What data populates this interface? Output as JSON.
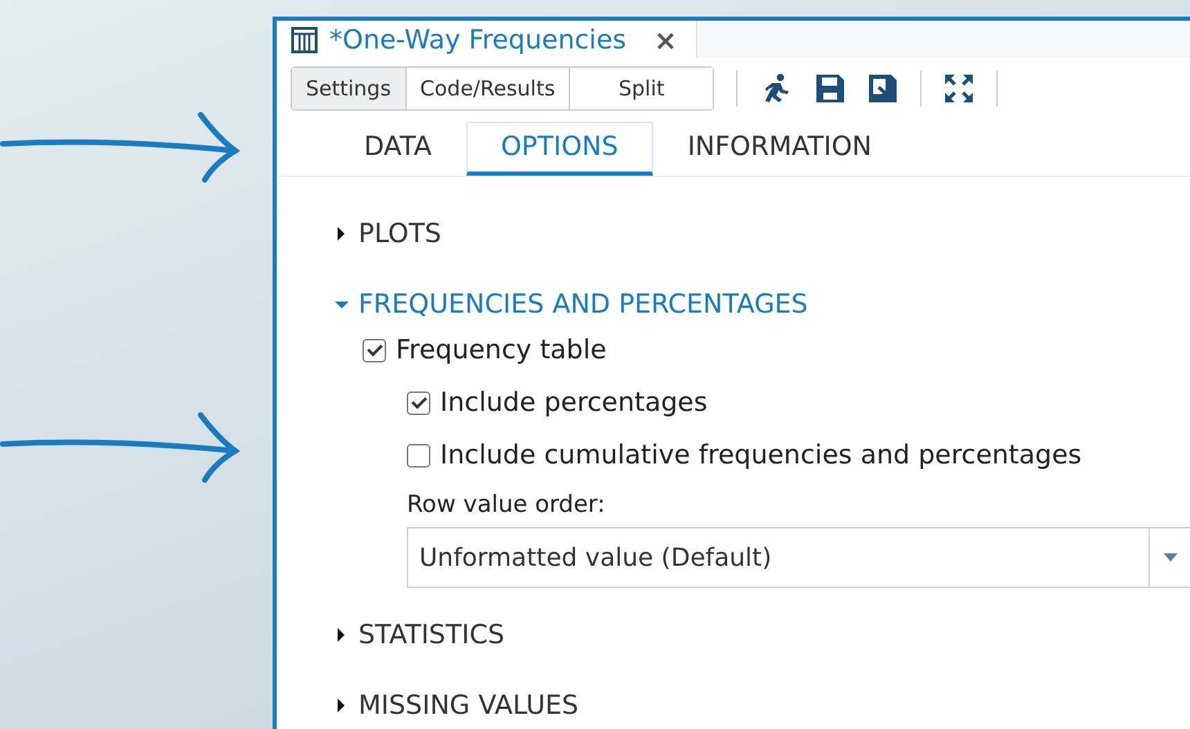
{
  "document_tab": {
    "title": "*One-Way Frequencies",
    "close": "×"
  },
  "view_buttons": [
    {
      "label": "Settings",
      "selected": true
    },
    {
      "label": "Code/Results",
      "selected": false
    },
    {
      "label": "Split",
      "selected": false
    }
  ],
  "tabs": [
    {
      "label": "DATA",
      "selected": false
    },
    {
      "label": "OPTIONS",
      "selected": true
    },
    {
      "label": "INFORMATION",
      "selected": false
    }
  ],
  "sections": [
    {
      "title": "PLOTS",
      "expanded": false
    },
    {
      "title": "FREQUENCIES AND PERCENTAGES",
      "expanded": true,
      "options": [
        {
          "label": "Frequency table",
          "checked": true,
          "children": [
            {
              "label": "Include percentages",
              "checked": true
            },
            {
              "label": "Include cumulative frequencies and percentages",
              "checked": false
            }
          ]
        }
      ],
      "dropdown": {
        "label": "Row value order:",
        "value": "Unformatted value (Default)"
      }
    },
    {
      "title": "STATISTICS",
      "expanded": false
    },
    {
      "title": "MISSING VALUES",
      "expanded": false
    }
  ]
}
